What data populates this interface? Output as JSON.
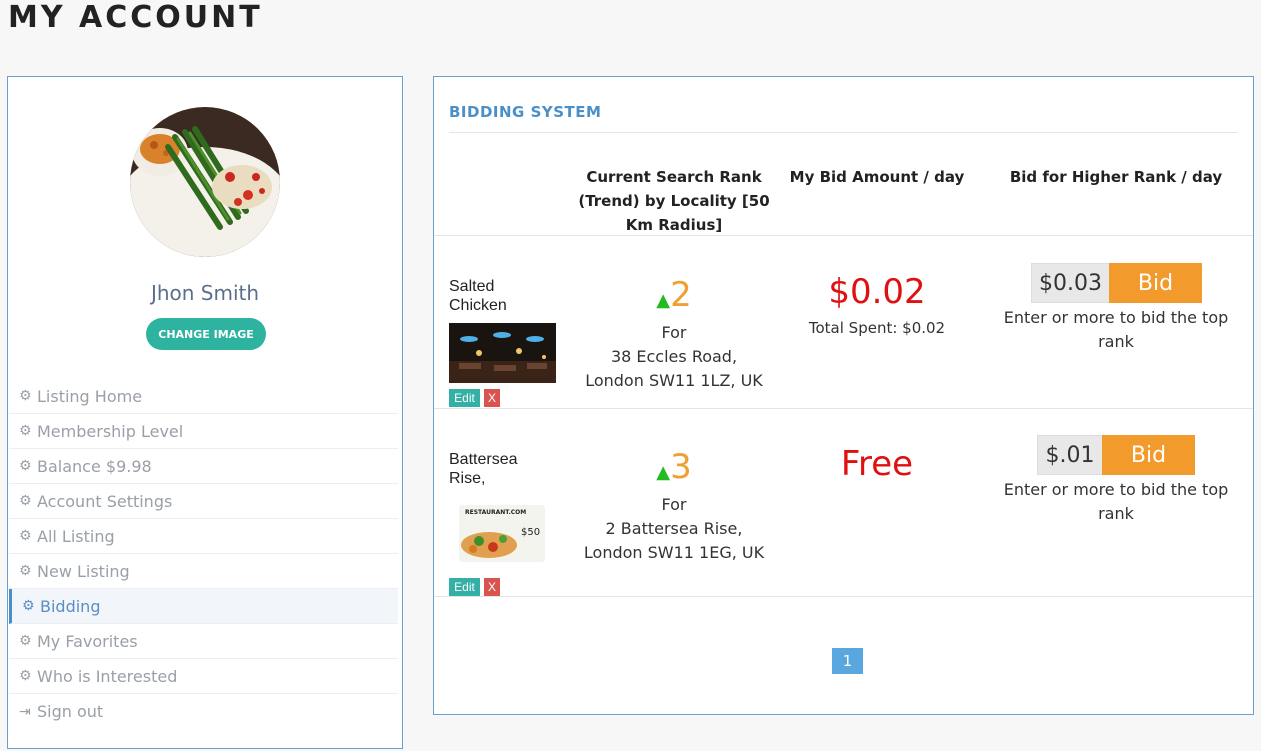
{
  "page": {
    "title": "MY ACCOUNT"
  },
  "profile": {
    "name": "Jhon Smith",
    "change_image_label": "CHANGE IMAGE"
  },
  "sidebar": {
    "items": [
      {
        "label": "Listing Home",
        "icon": "gear-icon"
      },
      {
        "label": "Membership Level",
        "icon": "gear-icon"
      },
      {
        "label": "Balance $9.98",
        "icon": "gear-icon"
      },
      {
        "label": "Account Settings",
        "icon": "gear-icon"
      },
      {
        "label": "All Listing",
        "icon": "gear-icon"
      },
      {
        "label": "New Listing",
        "icon": "gear-icon"
      },
      {
        "label": "Bidding",
        "icon": "gear-icon",
        "active": true
      },
      {
        "label": "My Favorites",
        "icon": "gear-icon"
      },
      {
        "label": "Who is Interested",
        "icon": "gear-icon"
      },
      {
        "label": "Sign out",
        "icon": "sign-out-icon"
      }
    ]
  },
  "bidding": {
    "title": "BIDDING SYSTEM",
    "headers": {
      "rank_line1": "Current Search Rank",
      "rank_line2": "(Trend) by Locality [50",
      "rank_line3": "Km Radius]",
      "bid_amount": "My Bid Amount / day",
      "higher_rank": "Bid for Higher Rank / day"
    },
    "rows": [
      {
        "name_line1": "Salted",
        "name_line2": "Chicken",
        "rank": "2",
        "trend_icon": "arrow-up-icon",
        "addr_line1": "For",
        "addr_line2": "38 Eccles Road,",
        "addr_line3": "London SW11 1LZ, UK",
        "bid_amount": "$0.02",
        "total_spent": "Total Spent: $0.02",
        "bid_value": "$0.03",
        "bid_button": "Bid",
        "hint_line1": "Enter or more to bid the top",
        "hint_line2": "rank",
        "edit_label": "Edit",
        "delete_label": "X"
      },
      {
        "name_line1": "Battersea",
        "name_line2": "Rise,",
        "rank": "3",
        "trend_icon": "arrow-up-icon",
        "addr_line1": "For",
        "addr_line2": "2 Battersea Rise,",
        "addr_line3": "London SW11 1EG, UK",
        "bid_amount": "Free",
        "bid_value": "$.01",
        "bid_button": "Bid",
        "hint_line1": "Enter or more to bid the top",
        "hint_line2": "rank",
        "edit_label": "Edit",
        "delete_label": "X",
        "thumb_caption": "RESTAURANT.COM",
        "thumb_value": "$50"
      }
    ],
    "pagination": {
      "current": "1"
    }
  },
  "colors": {
    "accent_blue": "#4a90c8",
    "teal": "#2fb3a1",
    "orange": "#f39a2c",
    "red": "#e01010",
    "trend_green": "#22bb22"
  }
}
